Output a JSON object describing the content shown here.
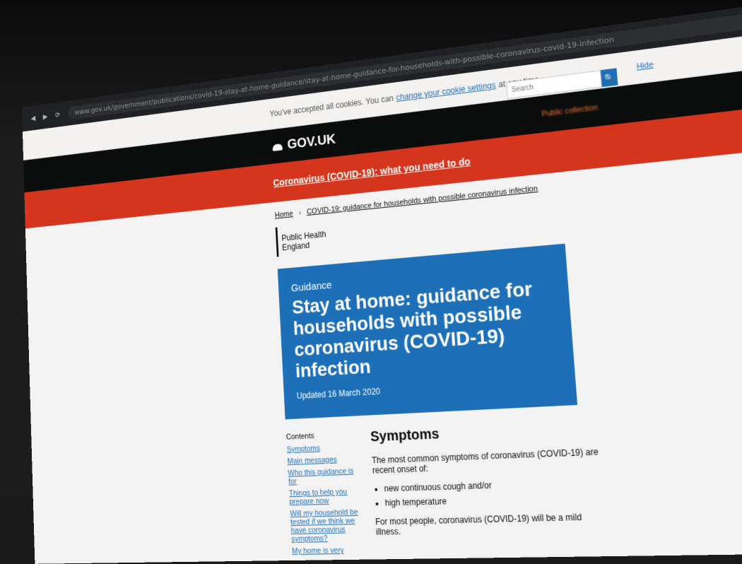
{
  "browser": {
    "nav_icons": [
      "back-icon",
      "forward-icon",
      "reload-icon"
    ],
    "url": "www.gov.uk/government/publications/covid-19-stay-at-home-guidance/stay-at-home-guidance-for-households-with-possible-coronavirus-covid-19-infection"
  },
  "cookie_banner": {
    "text_before": "You've accepted all cookies. You can",
    "link": "change your cookie settings",
    "text_after": "at any time.",
    "hide": "Hide"
  },
  "header": {
    "logo": "GOV.UK",
    "search_placeholder": "Search",
    "search_button": "🔍",
    "topics": "Public collection"
  },
  "alert": {
    "link": "Coronavirus (COVID-19): what you need to do"
  },
  "breadcrumb": {
    "home": "Home",
    "current": "COVID-19: guidance for households with possible coronavirus infection"
  },
  "organisation": {
    "line1": "Public Health",
    "line2": "England"
  },
  "hero": {
    "kicker": "Guidance",
    "title": "Stay at home: guidance for households with possible coronavirus (COVID-19) infection",
    "updated": "Updated 16 March 2020"
  },
  "contents": {
    "title": "Contents",
    "items": [
      "Symptoms",
      "Main messages",
      "Who this guidance is for",
      "Things to help you prepare now",
      "Will my household be tested if we think we have coronavirus symptoms?",
      "My home is very"
    ]
  },
  "article": {
    "heading": "Symptoms",
    "intro": "The most common symptoms of coronavirus (COVID-19) are recent onset of:",
    "bullets": [
      "new continuous cough and/or",
      "high temperature"
    ],
    "outro": "For most people, coronavirus (COVID-19) will be a mild illness."
  },
  "colors": {
    "govuk_black": "#0b0c0c",
    "govuk_blue": "#1d70b8",
    "govuk_red": "#d4351c"
  }
}
